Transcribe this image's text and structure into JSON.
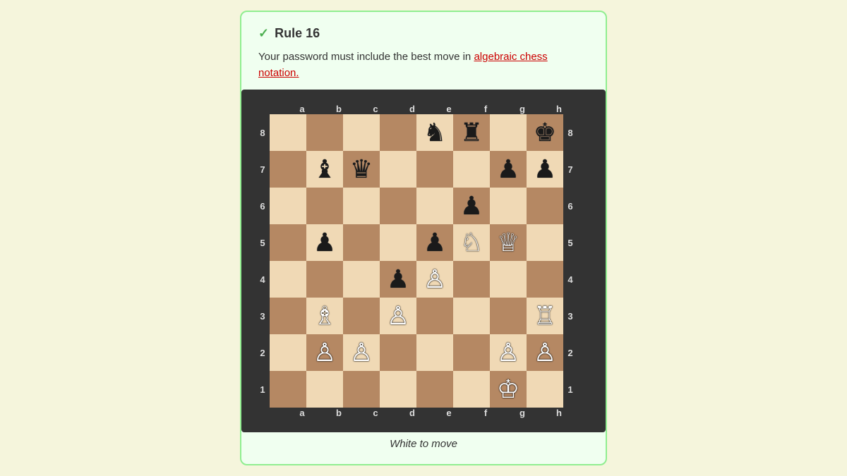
{
  "card": {
    "rule_number": "Rule 16",
    "description_plain": "Your password must include the best move in ",
    "description_link": "algebraic chess notation.",
    "description_link_url": "#",
    "caption": "White to move"
  },
  "board": {
    "files": [
      "a",
      "b",
      "c",
      "d",
      "e",
      "f",
      "g",
      "h"
    ],
    "ranks": [
      "8",
      "7",
      "6",
      "5",
      "4",
      "3",
      "2",
      "1"
    ],
    "pieces": {
      "e8": {
        "type": "knight",
        "color": "black"
      },
      "f8": {
        "type": "rook",
        "color": "black"
      },
      "h8": {
        "type": "king",
        "color": "black"
      },
      "b7": {
        "type": "bishop",
        "color": "black"
      },
      "c7": {
        "type": "queen",
        "color": "black"
      },
      "g7": {
        "type": "pawn",
        "color": "black"
      },
      "h7": {
        "type": "pawn",
        "color": "black"
      },
      "f6": {
        "type": "pawn",
        "color": "black"
      },
      "b5": {
        "type": "pawn",
        "color": "black"
      },
      "e5": {
        "type": "pawn",
        "color": "black"
      },
      "f5": {
        "type": "knight",
        "color": "white"
      },
      "g5": {
        "type": "queen",
        "color": "white"
      },
      "d4": {
        "type": "pawn",
        "color": "black"
      },
      "e4": {
        "type": "pawn",
        "color": "white"
      },
      "b3": {
        "type": "bishop",
        "color": "white"
      },
      "d3": {
        "type": "pawn",
        "color": "white"
      },
      "h3": {
        "type": "rook",
        "color": "white"
      },
      "b2": {
        "type": "pawn",
        "color": "white"
      },
      "c2": {
        "type": "pawn",
        "color": "white"
      },
      "g2": {
        "type": "pawn",
        "color": "white"
      },
      "h2": {
        "type": "pawn",
        "color": "white"
      },
      "g1": {
        "type": "king",
        "color": "white"
      }
    }
  }
}
